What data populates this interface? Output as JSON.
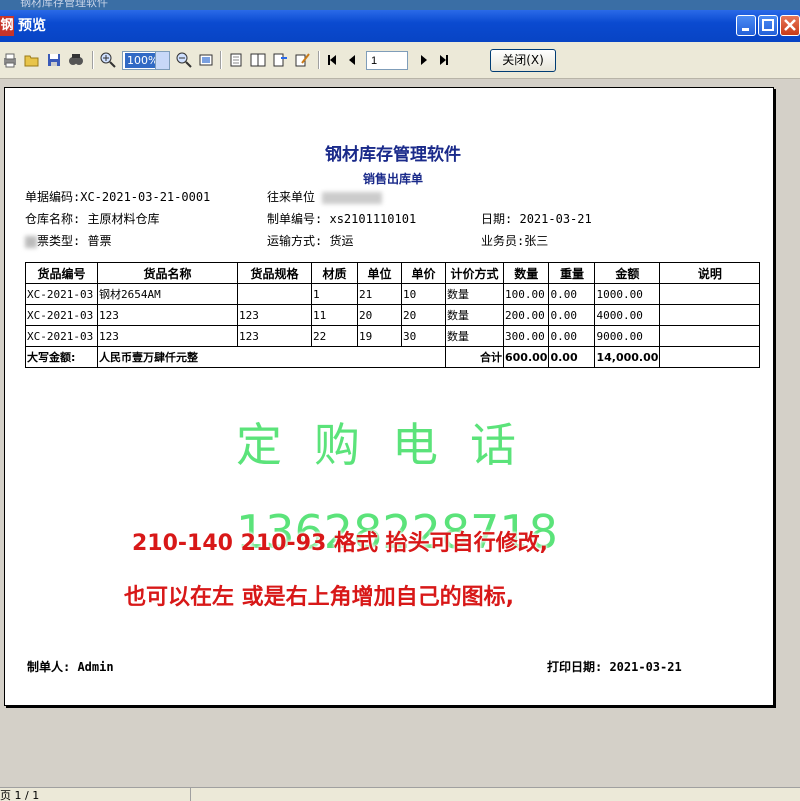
{
  "window": {
    "strip_title": "钢材库存管理软件",
    "title": "预览",
    "app_icon_char": "钢"
  },
  "toolbar": {
    "zoom": "100%",
    "page": "1",
    "close_label": "关闭(X)"
  },
  "document": {
    "title": "钢材库存管理软件",
    "subtitle": "销售出库单",
    "fields": {
      "doc_no_label": "单据编码:",
      "doc_no": "XC-2021-03-21-0001",
      "partner_label": "往来单位",
      "warehouse_label": "仓库名称:",
      "warehouse": "主原材料仓库",
      "order_no_label": "制单编号:",
      "order_no": "xs2101110101",
      "date_label": "日期:",
      "date": "2021-03-21",
      "invoice_label": "票类型:",
      "invoice": "普票",
      "transport_label": "运输方式:",
      "transport": "货运",
      "clerk_label": "业务员:",
      "clerk": "张三"
    },
    "table": {
      "headers": [
        "货品编号",
        "货品名称",
        "货品规格",
        "材质",
        "单位",
        "单价",
        "计价方式",
        "数量",
        "重量",
        "金额",
        "说明"
      ],
      "rows": [
        [
          "XC-2021-03",
          "钢材2654AM",
          "",
          "1",
          "21",
          "10",
          "数量",
          "100.00",
          "0.00",
          "1000.00",
          ""
        ],
        [
          "XC-2021-03",
          "123",
          "123",
          "11",
          "20",
          "20",
          "数量",
          "200.00",
          "0.00",
          "4000.00",
          ""
        ],
        [
          "XC-2021-03",
          "123",
          "123",
          "22",
          "19",
          "30",
          "数量",
          "300.00",
          "0.00",
          "9000.00",
          ""
        ]
      ],
      "total": {
        "label": "大写金额:",
        "words": "人民币壹万肆仟元整",
        "sum_label": "合计",
        "qty": "600.00",
        "weight": "0.00",
        "amount": "14,000.00"
      }
    },
    "footer": {
      "maker": "制单人: Admin",
      "print_date": "打印日期: 2021-03-21"
    }
  },
  "overlay": {
    "watermark1": "定购电话",
    "watermark2": "13628228718",
    "note1": "210-140  210-93 格式 抬头可自行修改,",
    "note2": "也可以在左 或是右上角增加自己的图标,"
  },
  "status": {
    "page_info": "页 1 / 1"
  }
}
